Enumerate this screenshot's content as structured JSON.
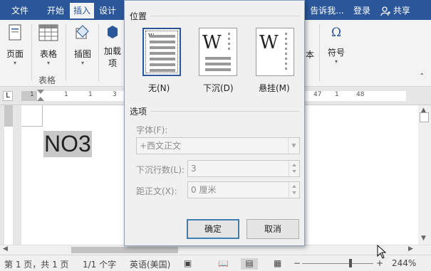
{
  "titlebar": {
    "tabs": [
      "文件",
      "开始",
      "插入",
      "设计"
    ],
    "active_tab": "插入",
    "right_items": [
      "告诉我...",
      "登录",
      "共享"
    ]
  },
  "ribbon": {
    "page_label": "页面",
    "table_label": "表格",
    "table_group_label": "表格",
    "illustration_label": "插图",
    "addins_label_line1": "加载",
    "addins_label_line2": "项",
    "text_label_partial": "本",
    "symbol_label": "符号"
  },
  "ruler": {
    "ticks": [
      "1",
      "1",
      "1",
      "3"
    ],
    "right_ticks": [
      "47",
      "1",
      "48"
    ]
  },
  "document": {
    "text": "NO3"
  },
  "dialog": {
    "position_title": "位置",
    "options": [
      {
        "label": "无(N)"
      },
      {
        "label": "下沉(D)"
      },
      {
        "label": "悬挂(M)"
      }
    ],
    "options_title": "选项",
    "font_label": "字体(F):",
    "font_value": "+西文正文",
    "lines_label": "下沉行数(L):",
    "lines_value": "3",
    "distance_label": "距正文(X):",
    "distance_value": "0 厘米",
    "ok_label": "确定",
    "cancel_label": "取消"
  },
  "statusbar": {
    "page": "第 1 页，共 1 页",
    "words": "1/1 个字",
    "language": "英语(美国)",
    "zoom": "244%"
  },
  "colors": {
    "accent": "#2b579a",
    "highlight": "#c8c8c8"
  }
}
